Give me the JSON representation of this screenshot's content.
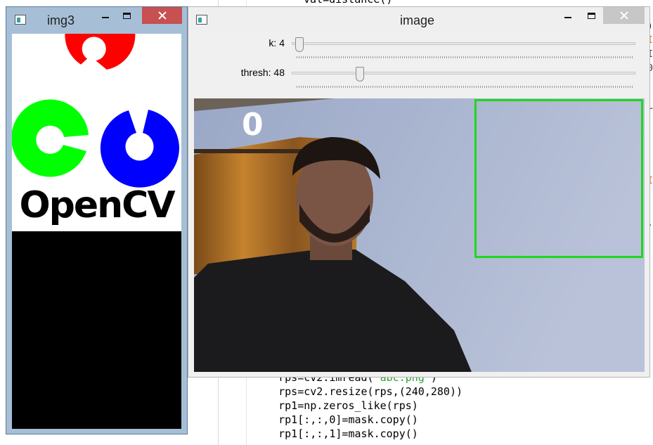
{
  "editor": {
    "lines": [
      {
        "pre": "    rps=cv2.imread(",
        "str": "'abc.png'",
        "post": ")"
      },
      {
        "pre": "    rps=cv2.resize(rps,(240,280))",
        "str": "",
        "post": ""
      },
      {
        "pre": "    rp1=np.zeros_like(rps)",
        "str": "",
        "post": ""
      },
      {
        "pre": "    rp1[:,:,0]=mask.copy()",
        "str": "",
        "post": ""
      },
      {
        "pre": "    rp1[:,:,1]=mask.copy()",
        "str": "",
        "post": ""
      }
    ],
    "top_fragment": "val=distance()"
  },
  "window_img3": {
    "title": "img3",
    "logo_text": "OpenCV",
    "colors": {
      "red": "#ff0000",
      "green": "#00ff00",
      "blue": "#0000ff"
    }
  },
  "window_image": {
    "title": "image",
    "trackbars": [
      {
        "label": "k: 4",
        "value": 4,
        "fraction": 0.01
      },
      {
        "label": "thresh: 48",
        "value": 48,
        "fraction": 0.19
      }
    ],
    "count_text": "0",
    "roi_color": "#1ed81e"
  },
  "icons": {
    "app": "app-window-icon",
    "minimize": "minimize-icon",
    "maximize": "maximize-icon",
    "close": "close-icon"
  }
}
